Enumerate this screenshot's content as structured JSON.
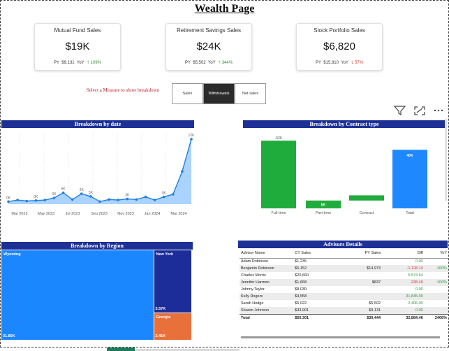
{
  "page": {
    "title": "Wealth Page"
  },
  "kpis": [
    {
      "title": "Mutual Fund Sales",
      "value": "$19K",
      "py_label": "PY",
      "py_value": "$9,131",
      "yoy_label": "YoY",
      "yoy_arrow": "↑",
      "yoy_value": "109%",
      "direction": "up"
    },
    {
      "title": "Retirement Savings Sales",
      "value": "$24K",
      "py_label": "PY",
      "py_value": "$5,502",
      "yoy_label": "YoY",
      "yoy_arrow": "↑",
      "yoy_value": "344%",
      "direction": "up"
    },
    {
      "title": "Stock Portfolio Sales",
      "value": "$6,820",
      "py_label": "PY",
      "py_value": "$15,810",
      "yoy_label": "YoY",
      "yoy_arrow": "↓",
      "yoy_value": "57%",
      "direction": "down"
    }
  ],
  "measure_selector": {
    "label": "Select a Measure to show breakdown",
    "options": [
      "Sales",
      "Withdrawals",
      "Net sales"
    ],
    "selected": "Withdrawals"
  },
  "visual_header_icons": [
    "filter-icon",
    "focus-mode-icon",
    "more-options-icon"
  ],
  "colors": {
    "header_bg": "#1c3096",
    "waterfall_green": "#1fac3c",
    "waterfall_blue": "#1e88ff",
    "line_blue": "#1f7fe0",
    "treemap_wyoming": "#1a86ff",
    "treemap_newyork": "#1c2c99",
    "treemap_georgia": "#e8703a"
  },
  "chart_data": [
    {
      "type": "area",
      "title": "Breakdown by date",
      "x_tick_labels": [
        "Mar 2023",
        "May 2023",
        "Jul 2023",
        "Sep 2023",
        "Nov 2023",
        "Jan 2024",
        "Mar 2024"
      ],
      "x": [
        "Feb 2023",
        "Mar 2023",
        "Apr 2023",
        "May 2023",
        "Jun 2023",
        "Jul 2023",
        "Aug 2023",
        "Sep 2023",
        "Oct 2023",
        "Nov 2023",
        "Dec 2023",
        "Jan 2024",
        "Feb 2024",
        "Mar 2024",
        "Apr 2024"
      ],
      "series": [
        {
          "values": [
            0.5,
            0.8,
            0.6,
            0.7,
            0.8,
            1.2,
            2.2,
            0.9,
            2.0,
            1.5,
            0.5,
            0.9,
            0.8,
            1.0,
            0.9,
            1.4,
            0.8,
            1.4,
            1.9,
            6.3,
            12.5
          ]
        }
      ],
      "data_labels": [
        "0K",
        "0K",
        "0K",
        "5K",
        "2K",
        "5K",
        "3K",
        "0K",
        "12K"
      ],
      "ylim": [
        0,
        14
      ]
    },
    {
      "type": "bar",
      "title": "Breakdown by Contract type",
      "subtype": "waterfall",
      "categories": [
        "Full-time",
        "Part-time",
        "Contract",
        "Total"
      ],
      "values": [
        -52,
        6,
        4,
        40
      ],
      "data_labels": [
        "-52K",
        "6K",
        "",
        "40K"
      ]
    },
    {
      "type": "heatmap",
      "subtype": "treemap",
      "title": "Breakdown by Region",
      "categories": [
        "Wyoming",
        "New York",
        "Georgia"
      ],
      "values": [
        31.85,
        5.57,
        2.41
      ],
      "data_labels": [
        "31.85K",
        "5.57K",
        "2.41K"
      ]
    },
    {
      "type": "table",
      "title": "Advisors Details",
      "columns": [
        "Advisor Name",
        "CY Sales",
        "PY Sales",
        "Diff",
        "YoY"
      ],
      "rows": [
        [
          "Adam Robinson",
          "$1,235",
          "",
          "0.00",
          ""
        ],
        [
          "Benjamin Robinson",
          "$5,152",
          "$14,973",
          "-1,128.14",
          "-100%"
        ],
        [
          "Charles Morris",
          "$20,660",
          "",
          "5,574.64",
          ""
        ],
        [
          "Jennifer Harmon",
          "$1,668",
          "$837",
          "-238.40",
          "-100%"
        ],
        [
          "Johnny Taylor",
          "$8,039",
          "",
          "0.00",
          ""
        ],
        [
          "Kelly Rogers",
          "$4,558",
          "",
          "31,845.00",
          ""
        ],
        [
          "Sarah Hodge",
          "$5,022",
          "$5,502",
          "2,406.00",
          ""
        ],
        [
          "Sharon Johnson",
          "$33,901",
          "$9,131",
          "0.00",
          ""
        ]
      ],
      "total": [
        "Total",
        "$50,301",
        "$30,444",
        "32,884.46",
        "2406%"
      ]
    }
  ]
}
